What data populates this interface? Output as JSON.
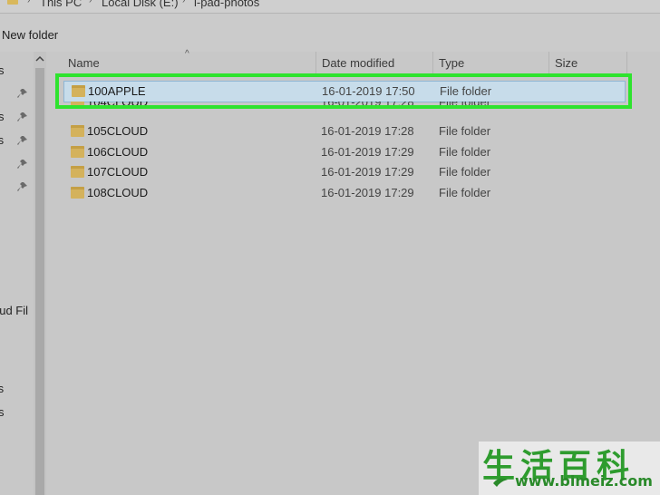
{
  "breadcrumb": {
    "items": [
      "This PC",
      "Local Disk (E:)",
      "i-pad-photos"
    ],
    "separator": "›"
  },
  "toolbar": {
    "new_folder_label": "New folder"
  },
  "nav_pane": {
    "partial_labels": [
      "s",
      "s",
      "ts",
      "oud Fil",
      "ts",
      "s"
    ]
  },
  "columns": {
    "name": "Name",
    "date": "Date modified",
    "type": "Type",
    "size": "Size"
  },
  "files": [
    {
      "name": "100APPLE",
      "date": "16-01-2019 17:50",
      "type": "File folder",
      "selected": true
    },
    {
      "name": "104CLOUD",
      "date": "16-01-2019 17:28",
      "type": "File folder"
    },
    {
      "name": "105CLOUD",
      "date": "16-01-2019 17:28",
      "type": "File folder"
    },
    {
      "name": "106CLOUD",
      "date": "16-01-2019 17:29",
      "type": "File folder"
    },
    {
      "name": "107CLOUD",
      "date": "16-01-2019 17:29",
      "type": "File folder"
    },
    {
      "name": "108CLOUD",
      "date": "16-01-2019 17:29",
      "type": "File folder"
    }
  ],
  "colors": {
    "highlight": "#2ee32e",
    "selection": "#c7dcea",
    "folder": "#d4b25c",
    "watermark": "#2e9c2e"
  },
  "watermark": {
    "chars": "生活百科",
    "url": "www.bimeiz.com"
  }
}
